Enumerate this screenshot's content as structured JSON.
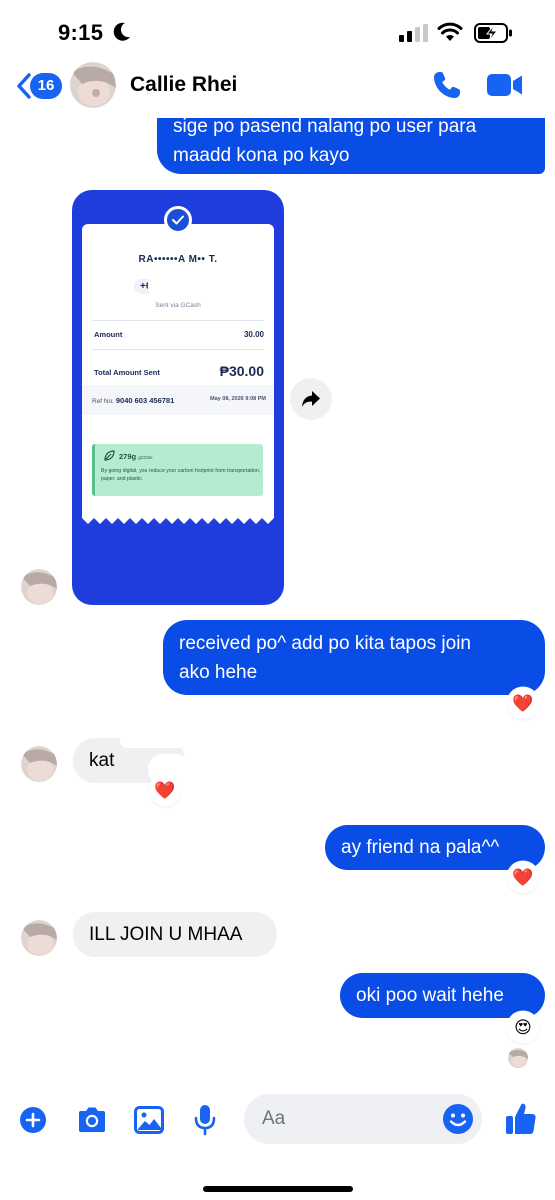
{
  "status_bar": {
    "time": "9:15"
  },
  "header": {
    "back_count": "16",
    "contact_name": "Callie Rhei"
  },
  "messages": {
    "m1_line1": "sige po pasend nalang po user para",
    "m1_line2": "maadd kona po kayo",
    "receipt": {
      "name": "RA••••••A M•• T.",
      "phone": "+63",
      "sent_via": "Sent via GCash",
      "amount_label": "Amount",
      "amount_value": "30.00",
      "total_label": "Total Amount Sent",
      "total_value": "₱30.00",
      "ref_label": "Ref No.",
      "ref_number": "9040 603 456781",
      "date": "May 08, 2026 9:08 PM",
      "carbon_value": "279g",
      "carbon_unit": "gCO2e",
      "carbon_text": "By going digital, you reduce your carbon footprint from transportation, paper, and plastic."
    },
    "m2_line1": "received po^ add po kita tapos join",
    "m2_line2": "ako hehe",
    "m3_text": "kat",
    "m4_text": "ay friend na pala^^",
    "m5_text": "ILL JOIN U MHAA",
    "m6_text": "oki poo wait hehe",
    "reactions": {
      "m2": "❤️",
      "m3": "❤️",
      "m4": "❤️",
      "m6": "😍"
    }
  },
  "composer": {
    "placeholder": "Aa"
  },
  "colors": {
    "messenger_blue": "#0a4de6",
    "accent_blue": "#1763f3",
    "gcash_blue": "#1f3ddd",
    "incoming_bubble": "#f0f0f2"
  },
  "icons": {
    "header": [
      "chevron-left-icon",
      "phone-icon",
      "video-camera-icon"
    ],
    "bottom_bar": [
      "plus-circle-icon",
      "camera-icon",
      "image-icon",
      "microphone-icon",
      "emoji-icon",
      "thumbs-up-icon"
    ]
  }
}
